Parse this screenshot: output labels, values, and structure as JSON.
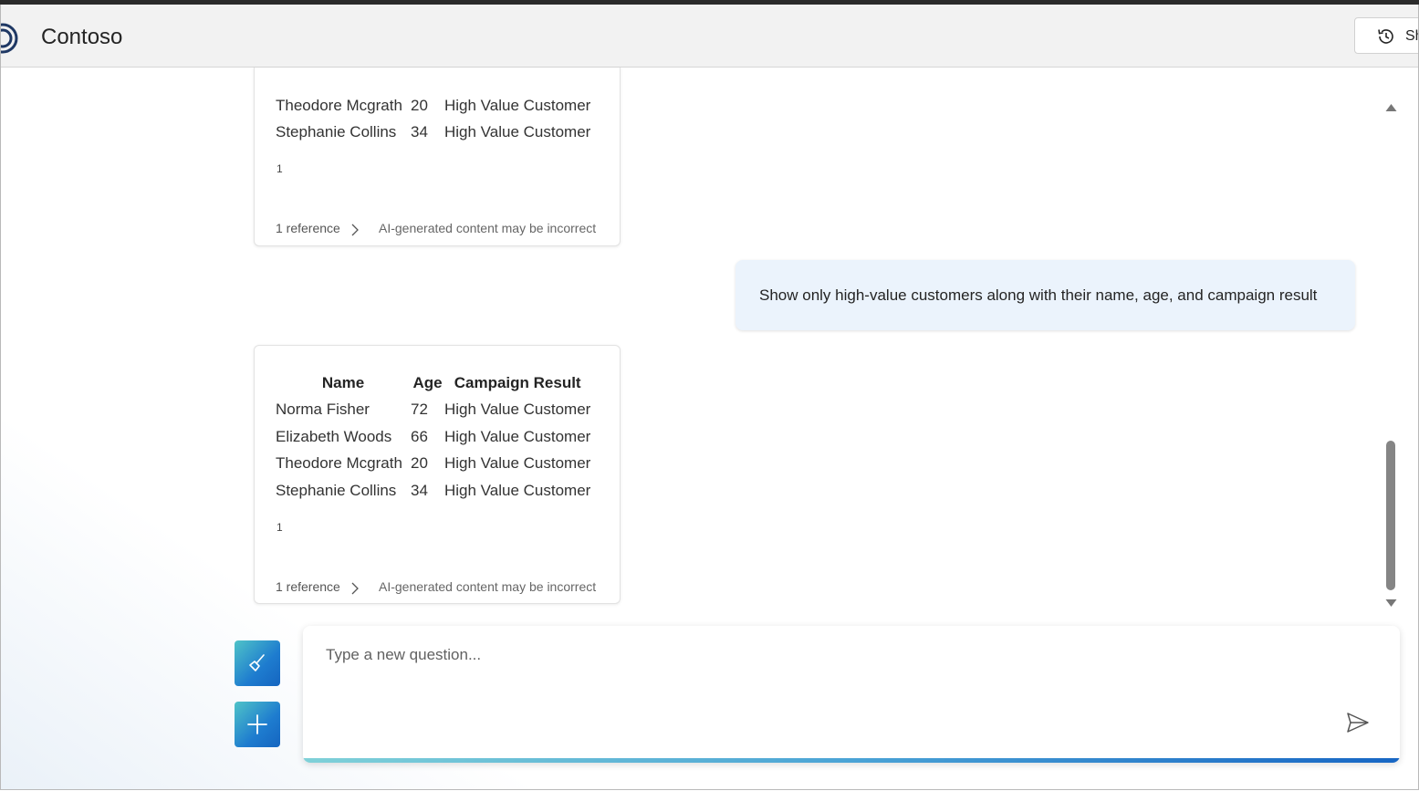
{
  "app": {
    "title": "Contoso"
  },
  "header": {
    "history_button_label": "Sh",
    "history_icon": "history-icon"
  },
  "messages": [
    {
      "role": "assistant",
      "table": {
        "headers": [],
        "rows": [
          [
            "Theodore Mcgrath",
            "20",
            "High Value Customer"
          ],
          [
            "Stephanie Collins",
            "34",
            "High Value Customer"
          ]
        ]
      },
      "citation_number": "1",
      "reference_label": "1 reference",
      "disclaimer": "AI-generated content may be incorrect"
    },
    {
      "role": "user",
      "text": "Show only high-value customers along with their name, age, and campaign result"
    },
    {
      "role": "assistant",
      "table": {
        "headers": [
          "Name",
          "Age",
          "Campaign Result"
        ],
        "rows": [
          [
            "Norma Fisher",
            "72",
            "High Value Customer"
          ],
          [
            "Elizabeth Woods",
            "66",
            "High Value Customer"
          ],
          [
            "Theodore Mcgrath",
            "20",
            "High Value Customer"
          ],
          [
            "Stephanie Collins",
            "34",
            "High Value Customer"
          ]
        ]
      },
      "citation_number": "1",
      "reference_label": "1 reference",
      "disclaimer": "AI-generated content may be incorrect"
    }
  ],
  "input": {
    "placeholder": "Type a new question..."
  },
  "side_buttons": [
    {
      "icon": "broom-icon",
      "label": ""
    },
    {
      "icon": "plus-icon",
      "label": ""
    }
  ],
  "colors": {
    "accent": "#1e7ccf",
    "user_bubble": "#ebf3fc",
    "header_bg": "#f2f2f2"
  }
}
